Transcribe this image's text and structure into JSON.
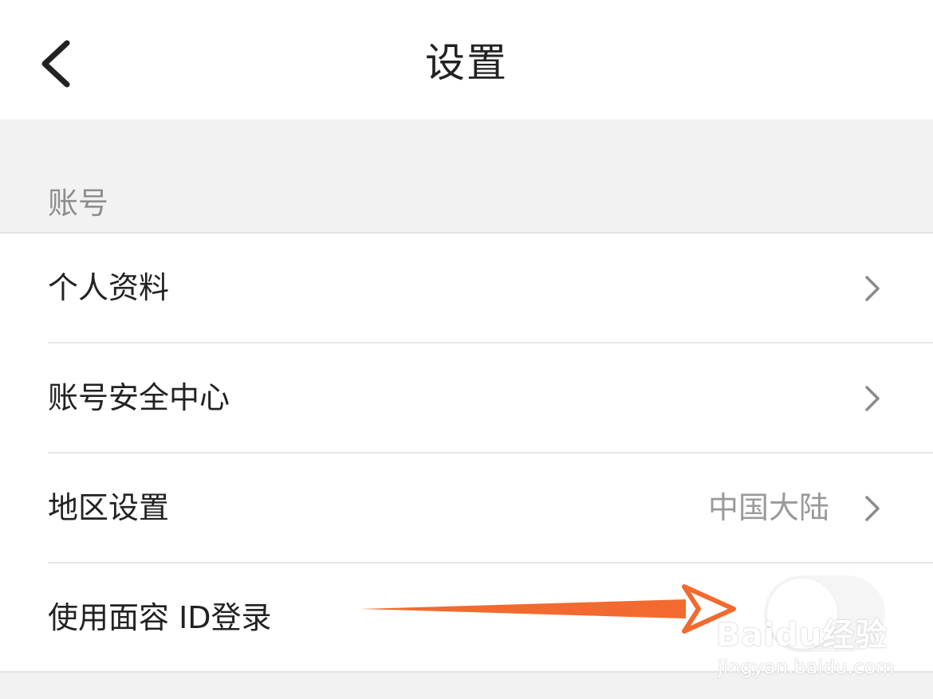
{
  "header": {
    "title": "设置",
    "back_icon": "chevron-left-icon"
  },
  "section": {
    "title": "账号"
  },
  "items": [
    {
      "label": "个人资料",
      "value": "",
      "icon": "chevron-right-icon"
    },
    {
      "label": "账号安全中心",
      "value": "",
      "icon": "chevron-right-icon"
    },
    {
      "label": "地区设置",
      "value": "中国大陆",
      "icon": "chevron-right-icon"
    },
    {
      "label": "使用面容 ID登录",
      "value": "",
      "control": "toggle",
      "toggle_state": "off"
    }
  ],
  "annotation": {
    "type": "arrow",
    "color": "#f26a2f"
  },
  "watermark": {
    "logo": "Baidu经验",
    "url": "jingyan.baidu.com"
  },
  "colors": {
    "text_primary": "#222222",
    "text_secondary": "#9a9a9a",
    "background": "#f2f2f2",
    "accent_arrow": "#f26a2f"
  }
}
